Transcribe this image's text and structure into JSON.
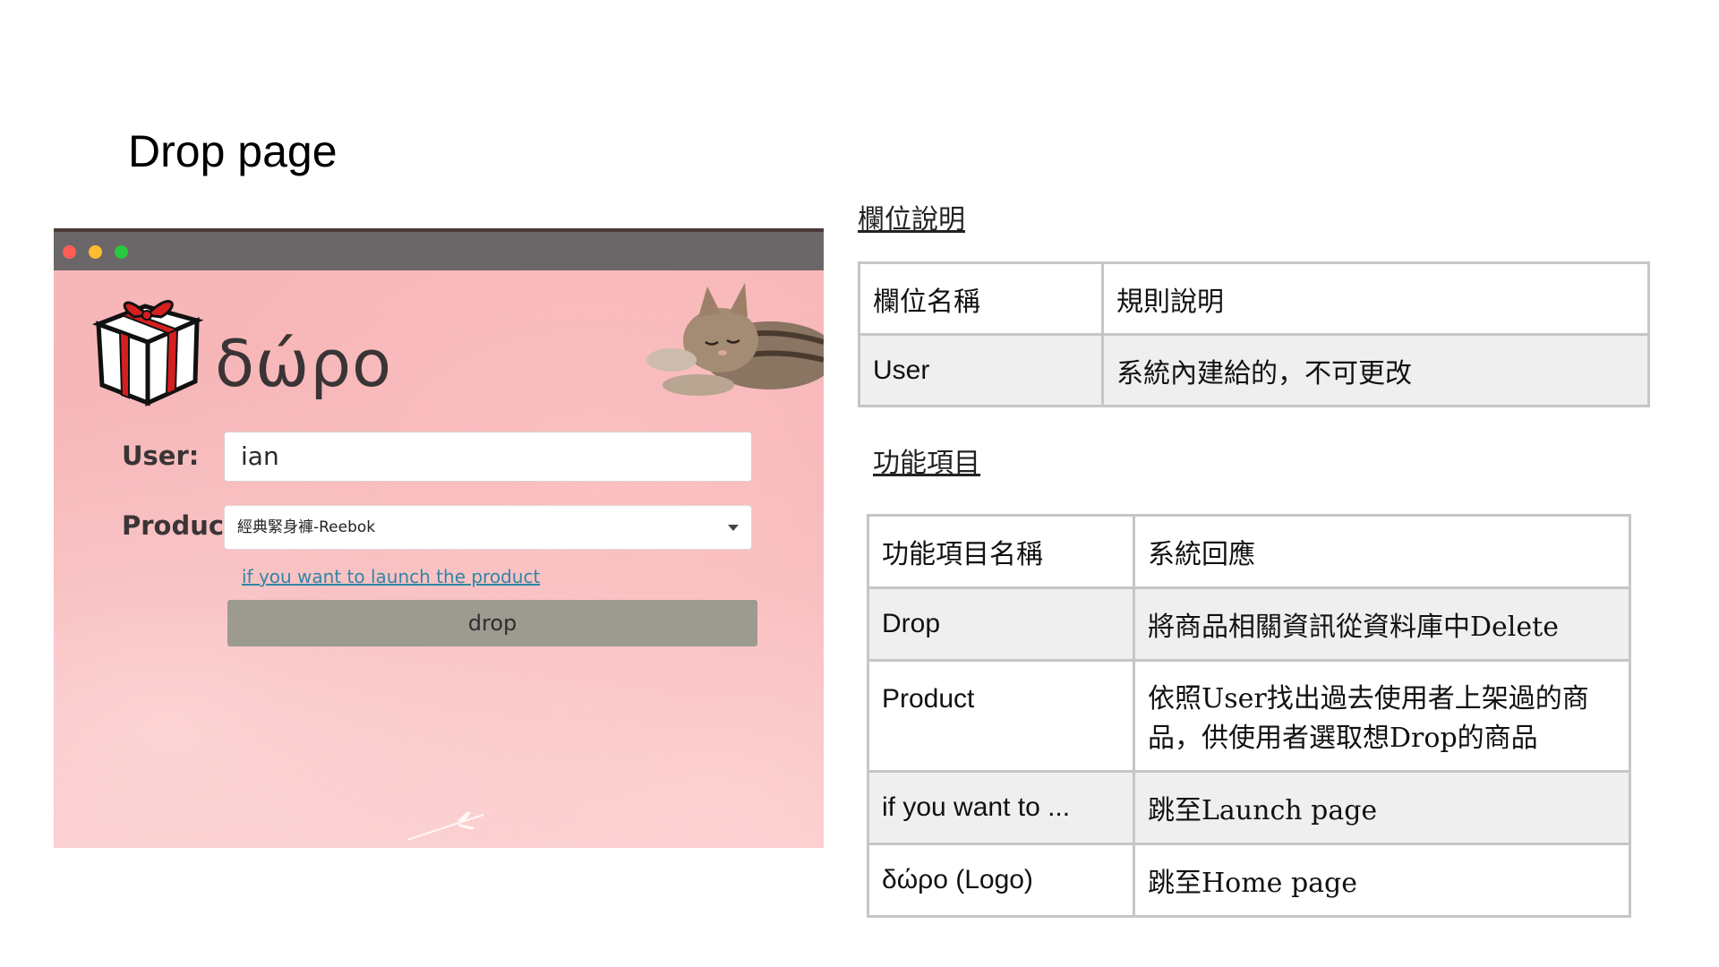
{
  "slide": {
    "title": "Drop page"
  },
  "app": {
    "logo_text": "δώρο",
    "user_label": "User:",
    "user_value": "ian",
    "product_label": "Product:",
    "product_selected": "經典緊身褲-Reebok",
    "launch_link": "if you want to launch the product",
    "drop_button": "drop",
    "colors": {
      "background": "#f6bcbc",
      "button": "#9d9a90",
      "link": "#2f86a6"
    }
  },
  "field_section": {
    "heading": "欄位說明",
    "header": [
      "欄位名稱",
      "規則說明"
    ],
    "rows": [
      [
        "User",
        "系統內建給的，不可更改"
      ]
    ]
  },
  "function_section": {
    "heading": "功能項目",
    "header": [
      "功能項目名稱",
      "系統回應"
    ],
    "rows": [
      [
        "Drop",
        "將商品相關資訊從資料庫中Delete"
      ],
      [
        "Product",
        "依照User找出過去使用者上架過的商品，供使用者選取想Drop的商品"
      ],
      [
        "if you want to ...",
        "跳至Launch page"
      ],
      [
        "δώρο (Logo)",
        "跳至Home page"
      ]
    ]
  }
}
